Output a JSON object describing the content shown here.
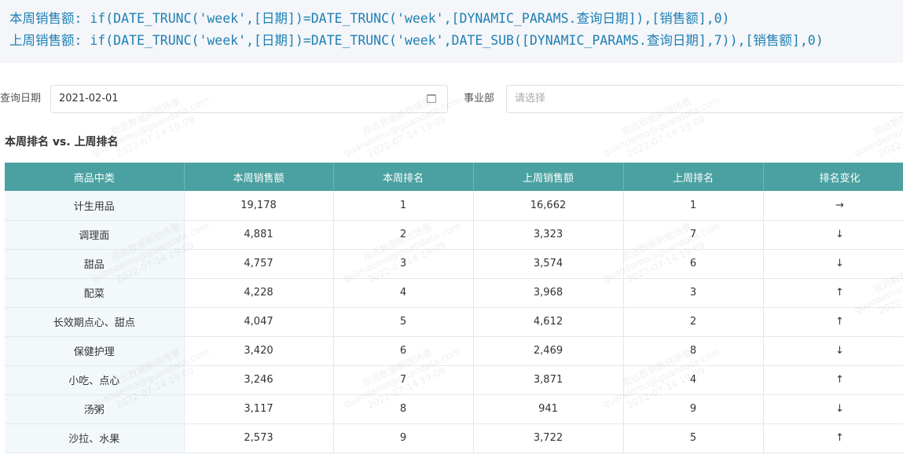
{
  "code_lines": [
    "本周销售额: if(DATE_TRUNC('week',[日期])=DATE_TRUNC('week',[DYNAMIC_PARAMS.查询日期]),[销售额],0)",
    "上周销售额: if(DATE_TRUNC('week',[日期])=DATE_TRUNC('week',DATE_SUB([DYNAMIC_PARAMS.查询日期],7)),[销售额],0)"
  ],
  "filters": {
    "date_label": "查询日期",
    "date_value": "2021-02-01",
    "dept_label": "事业部",
    "dept_placeholder": "请选择"
  },
  "card": {
    "title": "本周排名 vs. 上周排名"
  },
  "table": {
    "columns": [
      "商品中类",
      "本周销售额",
      "本周排名",
      "上周销售额",
      "上周排名",
      "排名变化"
    ],
    "rows": [
      [
        "计生用品",
        "19,178",
        "1",
        "16,662",
        "1",
        "→"
      ],
      [
        "调理面",
        "4,881",
        "2",
        "3,323",
        "7",
        "↓"
      ],
      [
        "甜品",
        "4,757",
        "3",
        "3,574",
        "6",
        "↓"
      ],
      [
        "配菜",
        "4,228",
        "4",
        "3,968",
        "3",
        "↑"
      ],
      [
        "长效期点心、甜点",
        "4,047",
        "5",
        "4,612",
        "2",
        "↑"
      ],
      [
        "保健护理",
        "3,420",
        "6",
        "2,469",
        "8",
        "↓"
      ],
      [
        "小吃、点心",
        "3,246",
        "7",
        "3,871",
        "4",
        "↑"
      ],
      [
        "汤粥",
        "3,117",
        "8",
        "941",
        "9",
        "↓"
      ],
      [
        "沙拉、水果",
        "2,573",
        "9",
        "3,722",
        "5",
        "↑"
      ]
    ]
  },
  "watermark": {
    "line1": "观远数据新锐场景",
    "line2": "guandemo@guandata.com",
    "line3": "2022-07-14 19:09"
  }
}
